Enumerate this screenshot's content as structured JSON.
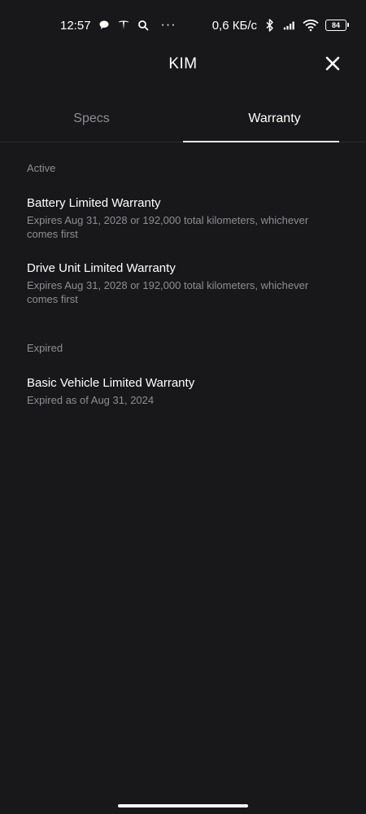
{
  "status_bar": {
    "time": "12:57",
    "net_speed": "0,6 КБ/с",
    "battery": "84",
    "left_icons": [
      "chat-bubble-icon",
      "tesla-logo-icon",
      "search-icon"
    ],
    "right_icons": [
      "bluetooth-icon",
      "signal-icon",
      "wifi-icon",
      "battery-icon"
    ]
  },
  "header": {
    "title": "KIM",
    "close_icon": "close-icon"
  },
  "tabs": [
    {
      "label": "Specs",
      "active": false
    },
    {
      "label": "Warranty",
      "active": true
    }
  ],
  "sections": {
    "active": {
      "label": "Active",
      "items": [
        {
          "title": "Battery Limited Warranty",
          "detail": "Expires Aug 31, 2028 or 192,000 total kilometers, whichever comes first"
        },
        {
          "title": "Drive Unit Limited Warranty",
          "detail": "Expires Aug 31, 2028 or 192,000 total kilometers, whichever comes first"
        }
      ]
    },
    "expired": {
      "label": "Expired",
      "items": [
        {
          "title": "Basic Vehicle Limited Warranty",
          "detail": "Expired as of Aug 31, 2024"
        }
      ]
    }
  },
  "colors": {
    "background": "#18181a",
    "text_primary": "#ffffff",
    "text_secondary": "#8e8e93",
    "divider": "#2c2c2e"
  }
}
